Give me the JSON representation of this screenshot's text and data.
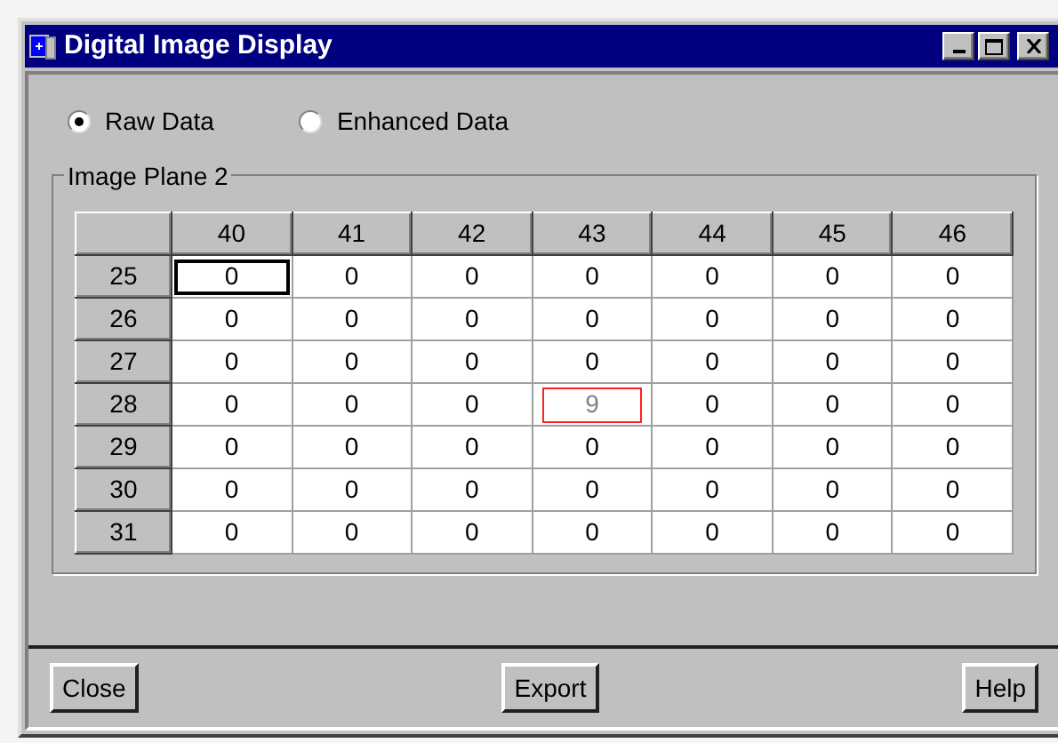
{
  "window": {
    "title": "Digital Image Display"
  },
  "display_modes": [
    {
      "label": "Raw Data",
      "selected": true
    },
    {
      "label": "Enhanced Data",
      "selected": false
    }
  ],
  "group": {
    "title": "Image Plane 2"
  },
  "table": {
    "columns": [
      "40",
      "41",
      "42",
      "43",
      "44",
      "45",
      "46"
    ],
    "rows": [
      {
        "label": "25",
        "cells": [
          {
            "value": "0",
            "focused": true,
            "flagged": false
          },
          {
            "value": "0",
            "focused": false,
            "flagged": false
          },
          {
            "value": "0",
            "focused": false,
            "flagged": false
          },
          {
            "value": "0",
            "focused": false,
            "flagged": false
          },
          {
            "value": "0",
            "focused": false,
            "flagged": false
          },
          {
            "value": "0",
            "focused": false,
            "flagged": false
          },
          {
            "value": "0",
            "focused": false,
            "flagged": false
          }
        ]
      },
      {
        "label": "26",
        "cells": [
          {
            "value": "0",
            "focused": false,
            "flagged": false
          },
          {
            "value": "0",
            "focused": false,
            "flagged": false
          },
          {
            "value": "0",
            "focused": false,
            "flagged": false
          },
          {
            "value": "0",
            "focused": false,
            "flagged": false
          },
          {
            "value": "0",
            "focused": false,
            "flagged": false
          },
          {
            "value": "0",
            "focused": false,
            "flagged": false
          },
          {
            "value": "0",
            "focused": false,
            "flagged": false
          }
        ]
      },
      {
        "label": "27",
        "cells": [
          {
            "value": "0",
            "focused": false,
            "flagged": false
          },
          {
            "value": "0",
            "focused": false,
            "flagged": false
          },
          {
            "value": "0",
            "focused": false,
            "flagged": false
          },
          {
            "value": "0",
            "focused": false,
            "flagged": false
          },
          {
            "value": "0",
            "focused": false,
            "flagged": false
          },
          {
            "value": "0",
            "focused": false,
            "flagged": false
          },
          {
            "value": "0",
            "focused": false,
            "flagged": false
          }
        ]
      },
      {
        "label": "28",
        "cells": [
          {
            "value": "0",
            "focused": false,
            "flagged": false
          },
          {
            "value": "0",
            "focused": false,
            "flagged": false
          },
          {
            "value": "0",
            "focused": false,
            "flagged": false
          },
          {
            "value": "9",
            "focused": false,
            "flagged": true
          },
          {
            "value": "0",
            "focused": false,
            "flagged": false
          },
          {
            "value": "0",
            "focused": false,
            "flagged": false
          },
          {
            "value": "0",
            "focused": false,
            "flagged": false
          }
        ]
      },
      {
        "label": "29",
        "cells": [
          {
            "value": "0",
            "focused": false,
            "flagged": false
          },
          {
            "value": "0",
            "focused": false,
            "flagged": false
          },
          {
            "value": "0",
            "focused": false,
            "flagged": false
          },
          {
            "value": "0",
            "focused": false,
            "flagged": false
          },
          {
            "value": "0",
            "focused": false,
            "flagged": false
          },
          {
            "value": "0",
            "focused": false,
            "flagged": false
          },
          {
            "value": "0",
            "focused": false,
            "flagged": false
          }
        ]
      },
      {
        "label": "30",
        "cells": [
          {
            "value": "0",
            "focused": false,
            "flagged": false
          },
          {
            "value": "0",
            "focused": false,
            "flagged": false
          },
          {
            "value": "0",
            "focused": false,
            "flagged": false
          },
          {
            "value": "0",
            "focused": false,
            "flagged": false
          },
          {
            "value": "0",
            "focused": false,
            "flagged": false
          },
          {
            "value": "0",
            "focused": false,
            "flagged": false
          },
          {
            "value": "0",
            "focused": false,
            "flagged": false
          }
        ]
      },
      {
        "label": "31",
        "cells": [
          {
            "value": "0",
            "focused": false,
            "flagged": false
          },
          {
            "value": "0",
            "focused": false,
            "flagged": false
          },
          {
            "value": "0",
            "focused": false,
            "flagged": false
          },
          {
            "value": "0",
            "focused": false,
            "flagged": false
          },
          {
            "value": "0",
            "focused": false,
            "flagged": false
          },
          {
            "value": "0",
            "focused": false,
            "flagged": false
          },
          {
            "value": "0",
            "focused": false,
            "flagged": false
          }
        ]
      }
    ]
  },
  "buttons": [
    "Close",
    "Export",
    "Help"
  ]
}
